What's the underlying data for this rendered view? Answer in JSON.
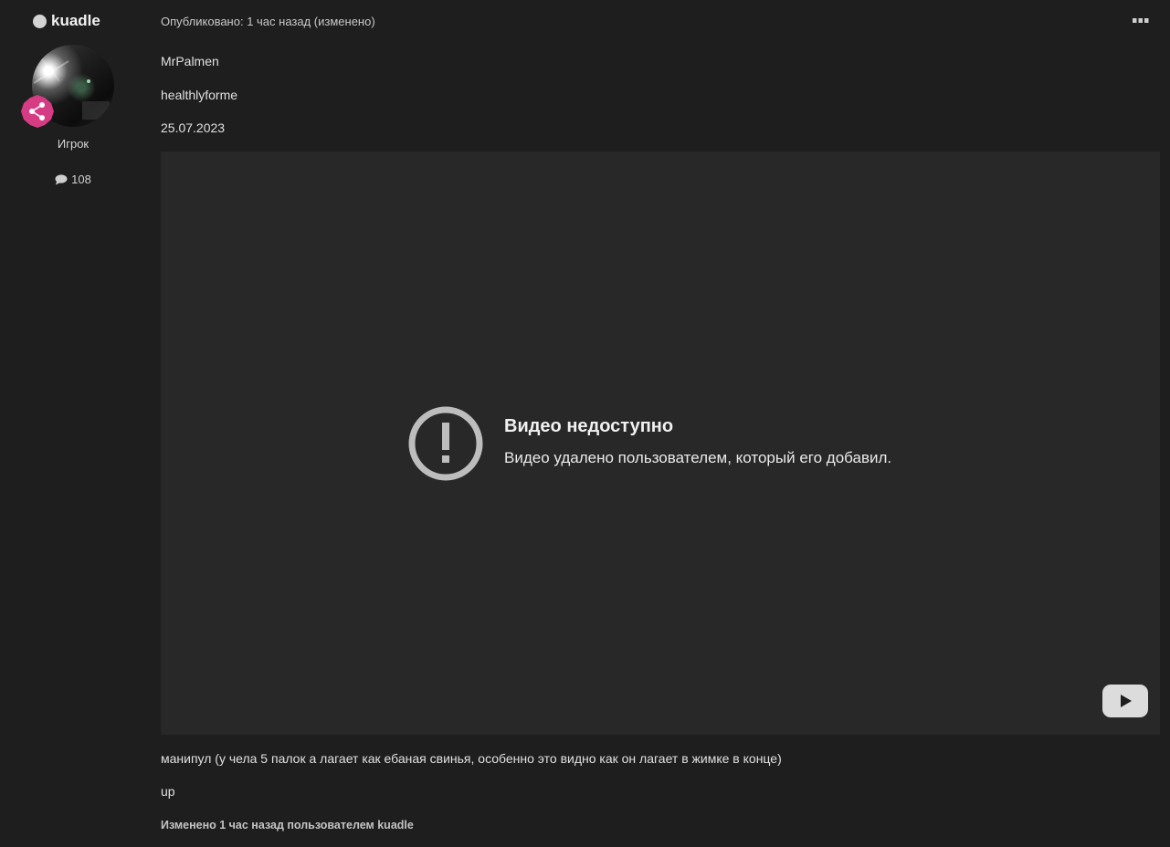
{
  "author": {
    "name": "kuadle",
    "title": "Игрок",
    "post_count": "108",
    "avatar_icon": "user-avatar-photo",
    "badge_icon": "share-icon",
    "badge_color": "#d63c84"
  },
  "post": {
    "meta": "Опубликовано: 1 час назад (изменено)",
    "lines": [
      "MrPalmen",
      "healthlyforme",
      "25.07.2023"
    ],
    "video": {
      "error_title": "Видео недоступно",
      "error_text": "Видео удалено пользователем, который его добавил.",
      "error_icon": "exclamation-circle-icon",
      "play_icon": "youtube-play-icon"
    },
    "after_lines": [
      "манипул (у чела 5 палок а лагает как ебаная свинья, особенно это видно как он лагает в жимке в конце)",
      "up"
    ],
    "edited_note": "Изменено 1 час назад пользователем kuadle"
  },
  "menu_icon": "ellipsis-icon"
}
